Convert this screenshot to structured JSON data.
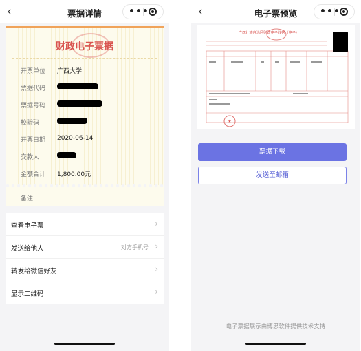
{
  "left_screen": {
    "nav": {
      "back_icon": "chevron-left-icon",
      "title": "票据详情",
      "more_icon": "more-dots-icon",
      "target_icon": "target-circle-icon"
    },
    "card": {
      "title": "财政电子票据",
      "rows": [
        {
          "label": "开票单位",
          "value": "广西大学"
        },
        {
          "label": "票据代码",
          "value": ""
        },
        {
          "label": "票据号码",
          "value": ""
        },
        {
          "label": "校验码",
          "value": ""
        },
        {
          "label": "开票日期",
          "value": "2020-06-14"
        },
        {
          "label": "交款人",
          "value": ""
        },
        {
          "label": "金额合计",
          "value": "1,800.00元"
        }
      ],
      "remark_label": "备注"
    },
    "menu": [
      {
        "label": "查看电子票",
        "hint": ""
      },
      {
        "label": "发送给他人",
        "hint": "对方手机号"
      },
      {
        "label": "转发给微信好友",
        "hint": ""
      },
      {
        "label": "显示二维码",
        "hint": ""
      }
    ]
  },
  "right_screen": {
    "nav": {
      "back_icon": "chevron-left-icon",
      "title": "电子票预览",
      "more_icon": "more-dots-icon",
      "target_icon": "target-circle-icon"
    },
    "preview": {
      "invoice_title": "广西壮族自治区财政电子收据（电子）"
    },
    "download_button": "票据下载",
    "email_button": "发送至邮箱",
    "footer_note": "电子票据展示由博思软件提供技术支持"
  },
  "colors": {
    "accent": "#6b73e3",
    "invoice_red": "#d9534f",
    "card_bg": "#fdfbed"
  }
}
